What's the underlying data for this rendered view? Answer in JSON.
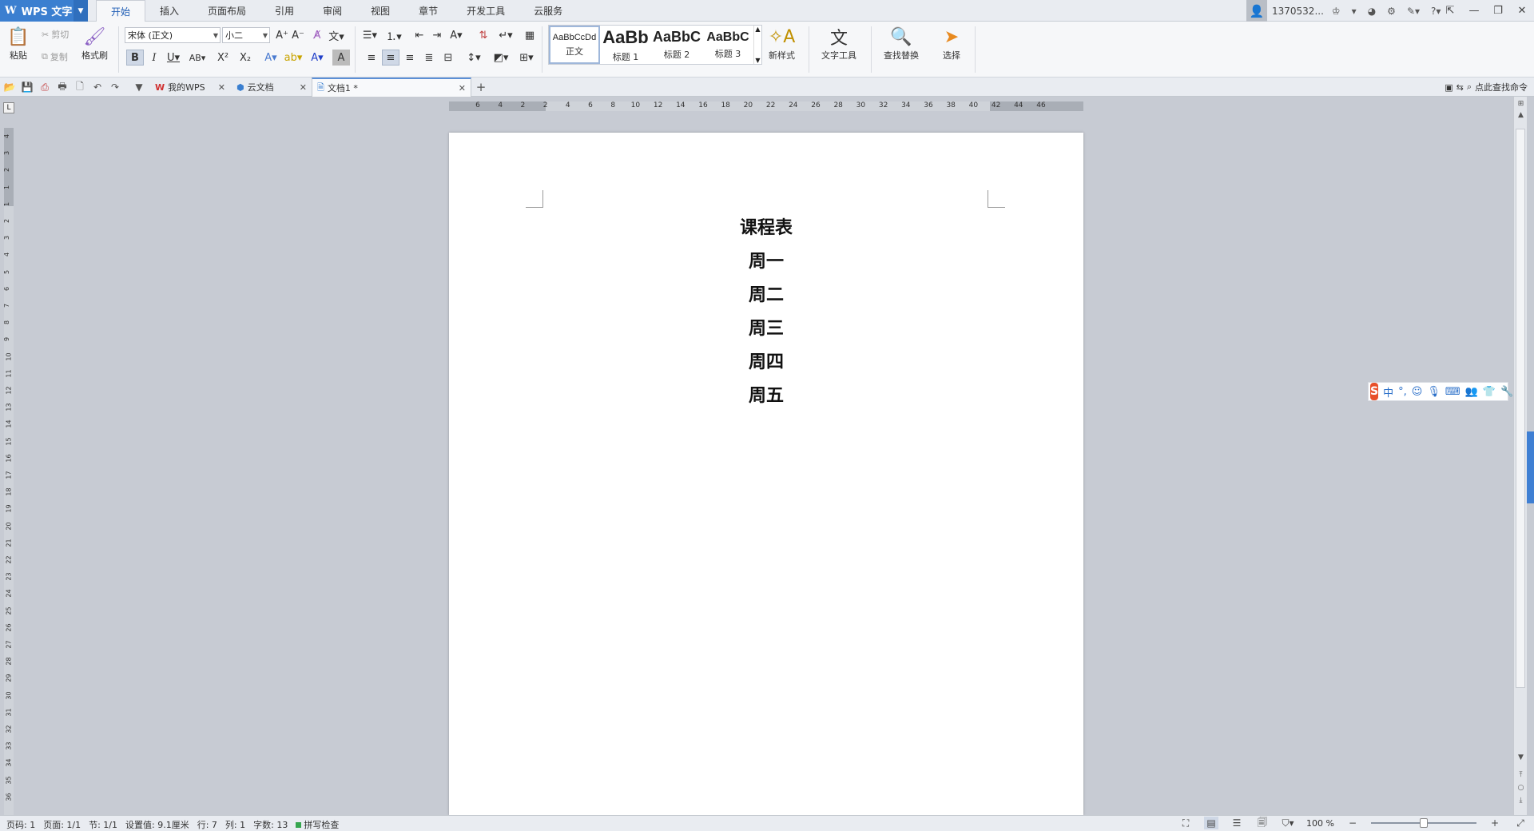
{
  "app": {
    "name": "WPS 文字",
    "logo_glyph": "W",
    "brand_color": "#3b7fd0"
  },
  "menu": {
    "tabs": [
      "开始",
      "插入",
      "页面布局",
      "引用",
      "审阅",
      "视图",
      "章节",
      "开发工具",
      "云服务"
    ],
    "active": "开始"
  },
  "account": {
    "name": "1370532..."
  },
  "ribbon": {
    "paste": "粘贴",
    "cut": "剪切",
    "copy": "复制",
    "format_painter": "格式刷",
    "font_name": "宋体 (正文)",
    "font_size": "小二",
    "styles": [
      {
        "sample": "AaBbCcDd",
        "name": "正文"
      },
      {
        "sample": "AaBb",
        "name": "标题 1"
      },
      {
        "sample": "AaBbC",
        "name": "标题 2"
      },
      {
        "sample": "AaBbC",
        "name": "标题 3"
      }
    ],
    "new_style": "新样式",
    "text_tools": "文字工具",
    "find_replace": "查找替换",
    "select": "选择"
  },
  "tabs_bar": {
    "tabs": [
      {
        "label": "我的WPS",
        "icon": "wps-logo-icon"
      },
      {
        "label": "云文档",
        "icon": "cloud-cube-icon"
      },
      {
        "label": "文档1 *",
        "icon": "document-icon"
      }
    ],
    "active": "文档1 *",
    "search_command": "点此查找命令"
  },
  "ruler": {
    "h_ticks": [
      "6",
      "4",
      "2",
      "2",
      "4",
      "6",
      "8",
      "10",
      "12",
      "14",
      "16",
      "18",
      "20",
      "22",
      "24",
      "26",
      "28",
      "30",
      "32",
      "34",
      "36",
      "38",
      "40",
      "42",
      "44",
      "46"
    ],
    "v_ticks": [
      "4",
      "3",
      "2",
      "1",
      "1",
      "2",
      "3",
      "4",
      "5",
      "6",
      "7",
      "8",
      "9",
      "10",
      "11",
      "12",
      "13",
      "14",
      "15",
      "16",
      "17",
      "18",
      "19",
      "20",
      "21",
      "22",
      "23",
      "24",
      "25",
      "26",
      "27",
      "28",
      "29",
      "30",
      "31",
      "32",
      "33",
      "34",
      "35",
      "36"
    ]
  },
  "document": {
    "lines": [
      "课程表",
      "周一",
      "周二",
      "周三",
      "周四",
      "周五"
    ]
  },
  "status": {
    "page_no": "页码: 1",
    "pages": "页面: 1/1",
    "section": "节: 1/1",
    "setting": "设置值: 9.1厘米",
    "row": "行: 7",
    "col": "列: 1",
    "word_count": "字数: 13",
    "spell": "拼写检查",
    "zoom": "100 %",
    "zoom_level": 0.5
  },
  "ime": {
    "lang": "中"
  }
}
